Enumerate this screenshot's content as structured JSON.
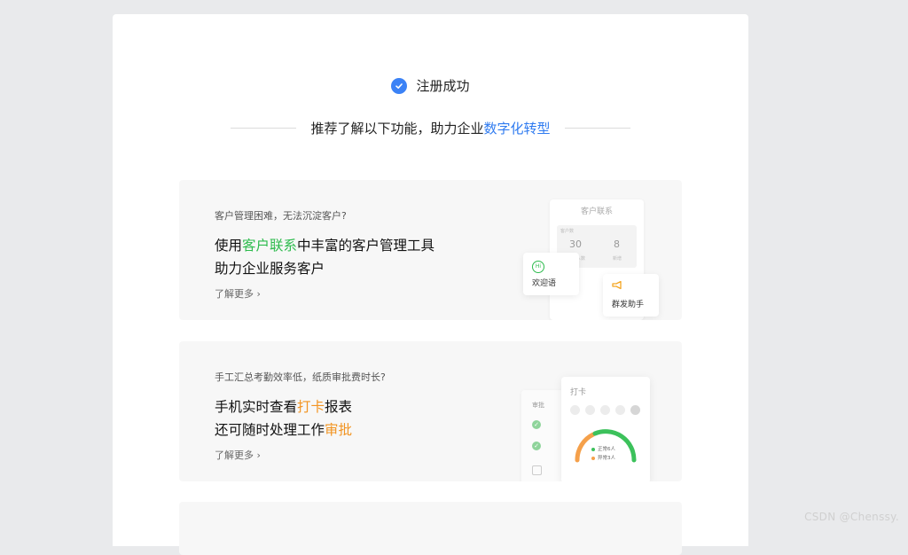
{
  "success": {
    "text": "注册成功"
  },
  "subtitle": {
    "prefix": "推荐了解以下功能，助力企业",
    "highlight": "数字化转型"
  },
  "cards": [
    {
      "question": "客户管理困难，无法沉淀客户?",
      "line1_pre": "使用",
      "line1_hl": "客户联系",
      "line1_post": "中丰富的客户管理工具",
      "line2_pre": "助力企业服务客户",
      "line2_hl": "",
      "more": "了解更多 ›",
      "illustration": {
        "title": "客户联系",
        "box_label": "客户数",
        "num1": "30",
        "num1_label": "客户人数",
        "num2": "8",
        "num2_label": "新增",
        "welcome_icon": "Hi",
        "welcome": "欢迎语",
        "group": "群发助手"
      }
    },
    {
      "question": "手工汇总考勤效率低，纸质审批费时长?",
      "line1_pre": "手机实时查看",
      "line1_hl": "打卡",
      "line1_post": "报表",
      "line2_pre": "还可随时处理工作",
      "line2_hl": "审批",
      "more": "了解更多 ›",
      "illustration": {
        "approve_title": "审批",
        "clock_title": "打卡",
        "legend_normal": "正常6人",
        "legend_abnormal": "异常3人"
      }
    }
  ],
  "watermark": "CSDN @Chenssy."
}
